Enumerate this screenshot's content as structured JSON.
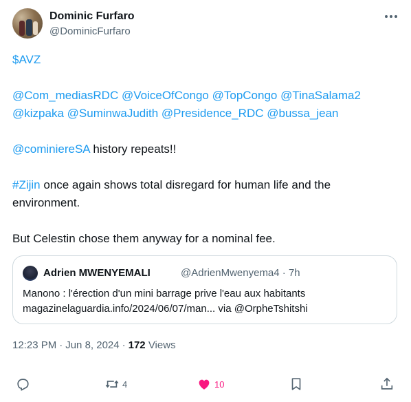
{
  "author": {
    "name": "Dominic Furfaro",
    "handle": "@DominicFurfaro"
  },
  "tweet": {
    "cashtag": "$AVZ",
    "mentions_line1": [
      "@Com_mediasRDC",
      "@VoiceOfCongo",
      "@TopCongo",
      "@TinaSalama2"
    ],
    "mentions_line2": [
      "@kizpaka",
      "@SuminwaJudith",
      "@Presidence_RDC",
      "@bussa_jean"
    ],
    "para3_mention": "@cominiereSA",
    "para3_text": " history repeats!!",
    "para4_hashtag": "#Zijin",
    "para4_text": " once again shows total disregard for human life and the environment.",
    "para5_text": "But Celestin chose them anyway for a nominal fee."
  },
  "quoted": {
    "name": "Adrien MWENYEMALI",
    "meta": "@AdrienMwenyema4 · 7h",
    "line1": "Manono : l'érection d'un mini barrage prive l'eau aux habitants",
    "line2_prefix": "magazinelaguardia.info/2024/06/07/man... via ",
    "line2_mention": "@OrpheTshitshi"
  },
  "meta": {
    "time": "12:23 PM",
    "date": "Jun 8, 2024",
    "views_count": "172",
    "views_label": "Views"
  },
  "actions": {
    "reply_count": "",
    "retweet_count": "4",
    "like_count": "10",
    "icons": [
      "reply-icon",
      "retweet-icon",
      "like-icon",
      "bookmark-icon",
      "share-icon"
    ]
  },
  "colors": {
    "link": "#1d9bf0",
    "like": "#f91880",
    "secondary_text": "#536471"
  }
}
